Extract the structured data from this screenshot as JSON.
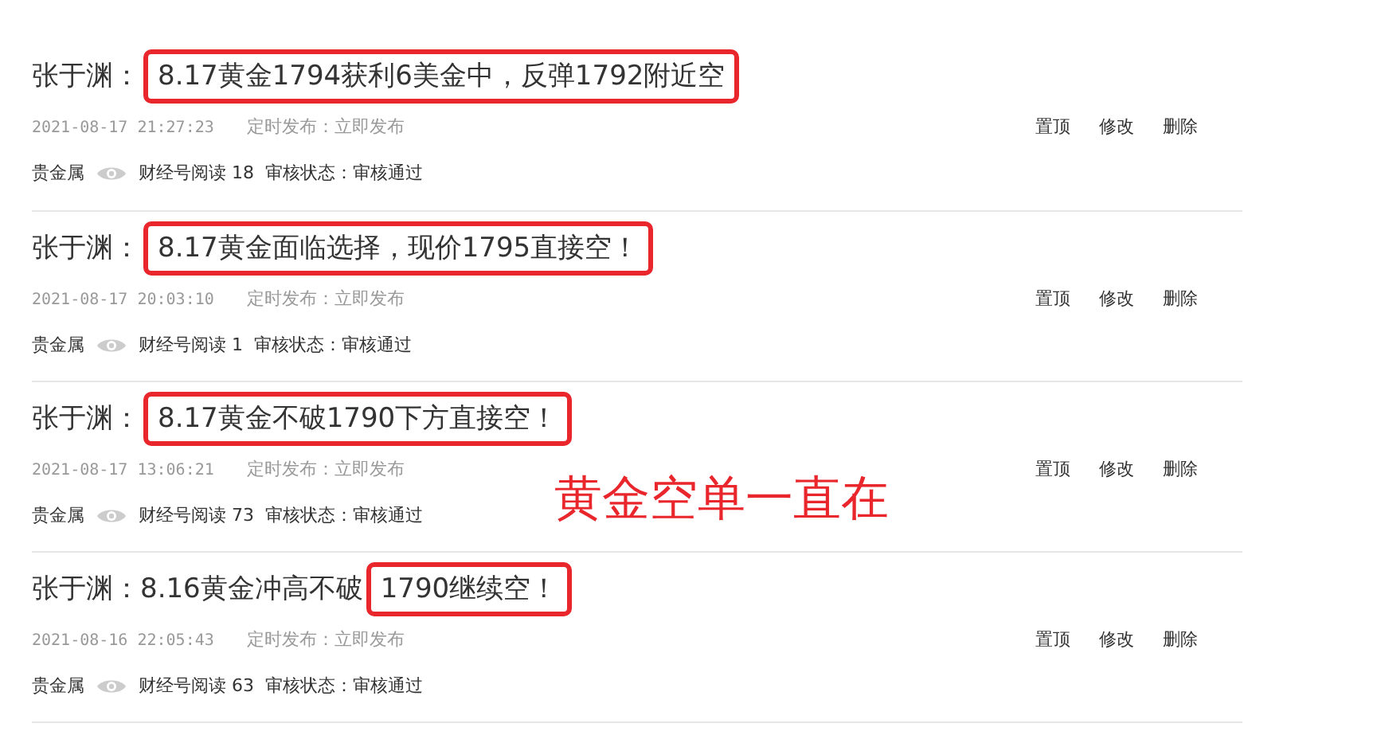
{
  "posts": [
    {
      "title_lead": "张于渊：",
      "title_marked": "8.17黄金1794获利6美金中，反弹1792附近空",
      "date": "2021-08-17 21:27:23",
      "schedule": "定时发布：立即发布",
      "category": "贵金属",
      "reads": "财经号阅读 18",
      "review": "审核状态：审核通过",
      "actions": [
        "置顶",
        "修改",
        "删除"
      ]
    },
    {
      "title_lead": "张于渊：",
      "title_marked": "8.17黄金面临选择，现价1795直接空！",
      "date": "2021-08-17 20:03:10",
      "schedule": "定时发布：立即发布",
      "category": "贵金属",
      "reads": "财经号阅读 1",
      "review": "审核状态：审核通过",
      "actions": [
        "置顶",
        "修改",
        "删除"
      ]
    },
    {
      "title_lead": "张于渊：",
      "title_marked": "8.17黄金不破1790下方直接空！",
      "date": "2021-08-17 13:06:21",
      "schedule": "定时发布：立即发布",
      "category": "贵金属",
      "reads": "财经号阅读 73",
      "review": "审核状态：审核通过",
      "actions": [
        "置顶",
        "修改",
        "删除"
      ]
    },
    {
      "title_lead": "张于渊：8.16黄金冲高不破",
      "title_marked": "1790继续空！",
      "date": "2021-08-16 22:05:43",
      "schedule": "定时发布：立即发布",
      "category": "贵金属",
      "reads": "财经号阅读 63",
      "review": "审核状态：审核通过",
      "actions": [
        "置顶",
        "修改",
        "删除"
      ]
    }
  ],
  "annotation": "黄金空单一直在"
}
